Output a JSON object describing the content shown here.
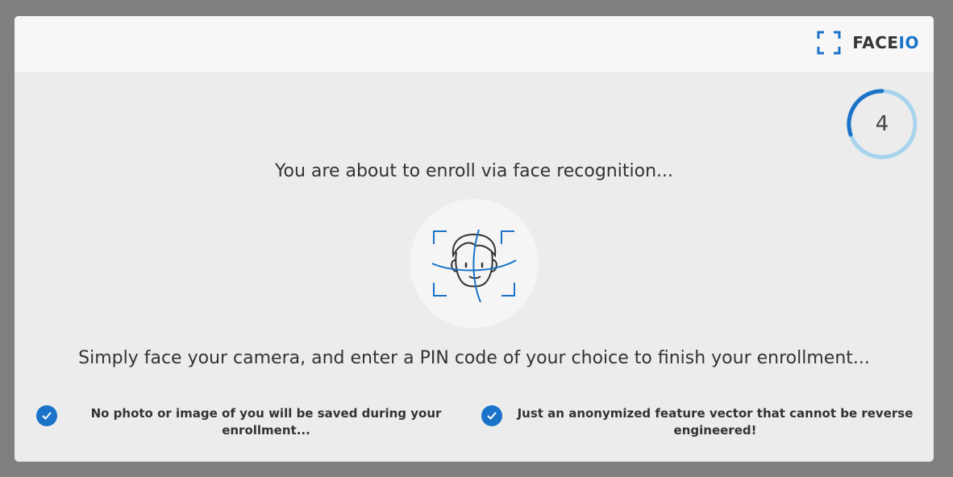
{
  "brand": {
    "logo_text_main": "FACE",
    "logo_text_accent": "IO",
    "accent_color": "#1a73c9"
  },
  "countdown": {
    "value": "4"
  },
  "main": {
    "title": "You are about to enroll via face recognition...",
    "illustration_icon": "face-scan-icon",
    "instruction": "Simply face your camera, and enter a PIN code of your choice to finish your enrollment..."
  },
  "features": [
    {
      "icon": "checkmark-icon",
      "text": "No photo or image of you will be saved during your enrollment..."
    },
    {
      "icon": "checkmark-icon",
      "text": "Just an anonymized feature vector that cannot be reverse engineered!"
    }
  ]
}
